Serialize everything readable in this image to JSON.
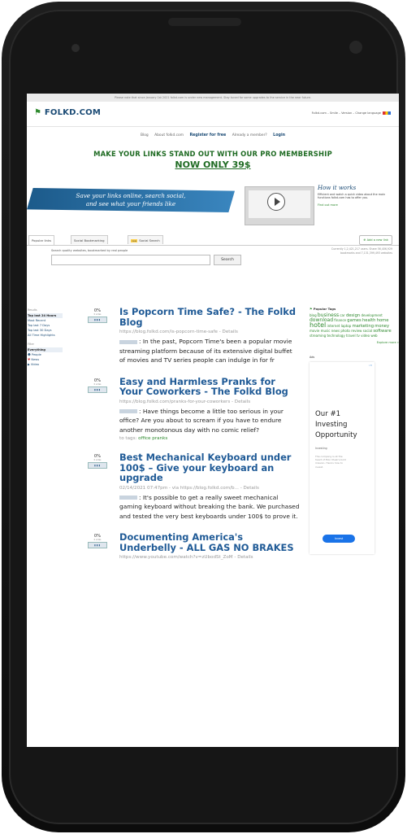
{
  "notice": "Please note that since January 1st 2021 folkd.com is under new management. Stay tuned for some upgrades to the service in the near future.",
  "header": {
    "logo": "FOLKD.COM",
    "status": "Folkd.com – Smile – Version – Change language",
    "nav": [
      "Blog",
      "About folkd.com",
      "Register for free",
      "Already a member?",
      "Login"
    ]
  },
  "promo": {
    "line1": "MAKE YOUR LINKS STAND OUT WITH OUR PRO MEMBERSHIP",
    "line2": "NOW ONLY 39$"
  },
  "hero": {
    "banner_line1": "Save your links online, search social,",
    "banner_line2": "and see what your friends like",
    "how_title": "How it works",
    "how_text": "Efficient and watch a quick video about the main functions folkd.com has to offer you.",
    "how_link": "Find out more"
  },
  "tabs": {
    "items": [
      "Popular links",
      "Social Bookmarking",
      "Social Search"
    ],
    "new_badge": "new",
    "add_link": "Add a new link"
  },
  "search": {
    "label": "Search quality websites, bookmarked by real people",
    "button": "Search",
    "stats": "Currently 1,2,421,217 users. Share 56,406,929 bookmarks and 7,131,399,493 websites"
  },
  "left": {
    "section1": "Results",
    "items": [
      "Top last 24 Hours",
      "Most Recent",
      "Top last 7 Days",
      "Top last 30 Days",
      "All Time Highlights"
    ],
    "section2": "Filter",
    "filters": [
      "Everything",
      "People",
      "News",
      "Video"
    ]
  },
  "posts": [
    {
      "pct": "0%",
      "votes": "0 votes",
      "title": "Is Popcorn Time Safe? - The Folkd Blog",
      "url": "https://blog.folkd.com/is-popcorn-time-safe - Details",
      "desc": ": In the past, Popcorn Time's been a popular movie streaming platform because of its extensive digital buffet of movies and TV series people can indulge in for fr",
      "tags_label": "",
      "tags": ""
    },
    {
      "pct": "0%",
      "votes": "0 votes",
      "title": "Easy and Harmless Pranks for Your Coworkers - The Folkd Blog",
      "url": "https://blog.folkd.com/pranks-for-your-coworkers - Details",
      "desc": ": Have things become a little too serious in your office? Are you about to scream if you have to endure another monotonous day with no comic relief?",
      "tags_label": "to tags:",
      "tags": "office pranks"
    },
    {
      "pct": "0%",
      "votes": "0 votes",
      "title": "Best Mechanical Keyboard under 100$ – Give your keyboard an upgrade",
      "url": "02/14/2021 07:47pm - via https://blog.folkd.com/b... - Details",
      "desc": ": It's possible to get a really sweet mechanical gaming keyboard without breaking the bank. We purchased and tested the very best keyboards under 100$ to prove it.",
      "tags_label": "",
      "tags": ""
    },
    {
      "pct": "0%",
      "votes": "0 votes",
      "title": "Documenting America's Underbelly - ALL GAS NO BRAKES",
      "url": "https://www.youtube.com/watch?v=zUbodSt_ZoM - Details",
      "desc": "",
      "tags_label": "",
      "tags": ""
    }
  ],
  "right": {
    "popular_tags": "Popular Tags",
    "tags": [
      "blog",
      "business",
      "car",
      "design",
      "development",
      "download",
      "finance",
      "games",
      "health",
      "home",
      "hotel",
      "internet",
      "laptop",
      "marketing",
      "money",
      "movie",
      "music",
      "news",
      "photo",
      "review",
      "social",
      "software",
      "streaming",
      "technology",
      "travel",
      "tv",
      "video",
      "web"
    ],
    "more": "Explore more »",
    "ads_label": "Ads",
    "ad_title": "Our #1 Investing Opportunity",
    "ad_small": "Investing",
    "ad_text": "The company is at the heart of Elon Musk's bold mission. Here's how to invest.",
    "ad_button": "Invest",
    "ad_info": "i ✕"
  }
}
